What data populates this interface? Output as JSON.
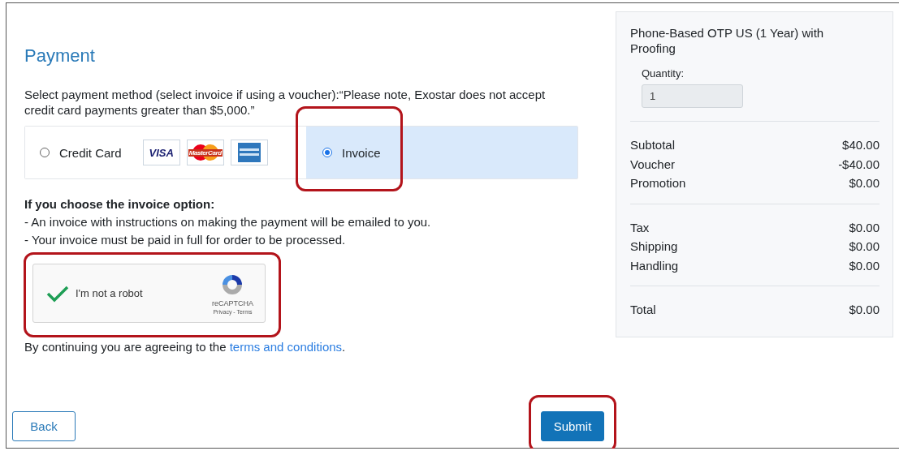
{
  "title": "Payment",
  "instructions": "Select payment method (select invoice if using a voucher):“Please note, Exostar does not accept credit card payments greater than $5,000.”",
  "payment_methods": [
    {
      "kind": "card",
      "label": "Credit Card",
      "selected": false,
      "highlighted": false,
      "logos": [
        {
          "kind": "visa",
          "text": "VISA"
        },
        {
          "kind": "mastercard",
          "text": "MasterCard"
        },
        {
          "kind": "amex"
        }
      ]
    },
    {
      "kind": "invoice",
      "label": "Invoice",
      "selected": true,
      "highlighted": true
    }
  ],
  "invoice_info": {
    "heading": "If you choose the invoice option:",
    "lines": [
      "- An invoice with instructions on making the payment will be emailed to you.",
      "- Your invoice must be paid in full for order to be processed."
    ]
  },
  "captcha": {
    "label": "I'm not a robot",
    "checked": true,
    "highlighted": true,
    "brand": "reCAPTCHA",
    "links": "Privacy - Terms"
  },
  "agreement": {
    "text": "By continuing you are agreeing to the ",
    "link": "terms and conditions",
    "end": "."
  },
  "buttons": [
    {
      "kind": "secondary",
      "label": "Back",
      "highlighted": false
    },
    {
      "kind": "primary",
      "label": "Submit",
      "highlighted": true
    }
  ],
  "summary": {
    "product": "Phone-Based OTP US (1 Year) with Proofing",
    "quantity_label": "Quantity:",
    "quantity": "1",
    "groups": [
      [
        {
          "label": "Subtotal",
          "value": "$40.00"
        },
        {
          "label": "Voucher",
          "value": "-$40.00"
        },
        {
          "label": "Promotion",
          "value": "$0.00"
        }
      ],
      [
        {
          "label": "Tax",
          "value": "$0.00"
        },
        {
          "label": "Shipping",
          "value": "$0.00"
        },
        {
          "label": "Handling",
          "value": "$0.00"
        }
      ],
      [
        {
          "label": "Total",
          "value": "$0.00"
        }
      ]
    ]
  }
}
